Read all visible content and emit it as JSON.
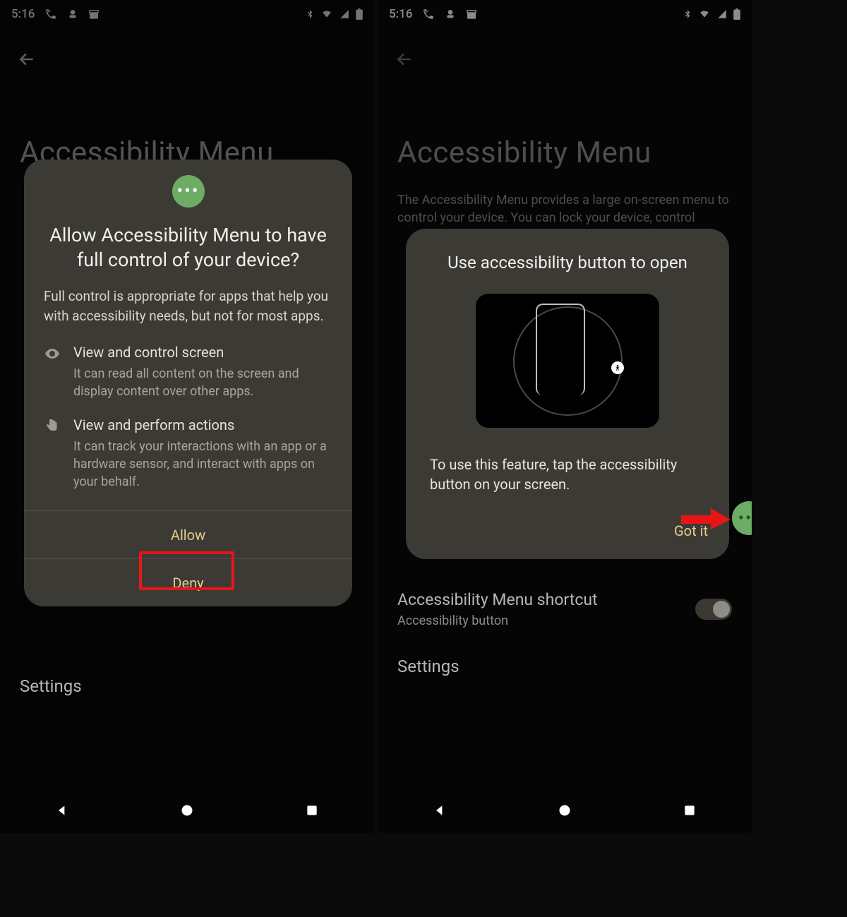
{
  "status": {
    "time": "5:16"
  },
  "page": {
    "title": "Accessibility Menu",
    "description": "The Accessibility Menu provides a large on-screen menu to control your device. You can lock your device, control",
    "settings": "Settings",
    "shortcut_title": "Accessibility Menu shortcut",
    "shortcut_sub": "Accessibility button"
  },
  "dialog_left": {
    "title": "Allow Accessibility Menu to have full control of your device?",
    "body": "Full control is appropriate for apps that help you with accessibility needs, but not for most apps.",
    "perm1_title": "View and control screen",
    "perm1_desc": "It can read all content on the screen and display content over other apps.",
    "perm2_title": "View and perform actions",
    "perm2_desc": "It can track your interactions with an app or a hardware sensor, and interact with apps on your behalf.",
    "allow": "Allow",
    "deny": "Deny"
  },
  "dialog_right": {
    "title": "Use accessibility button to open",
    "body": "To use this feature, tap the accessibility button on your screen.",
    "gotit": "Got it"
  }
}
